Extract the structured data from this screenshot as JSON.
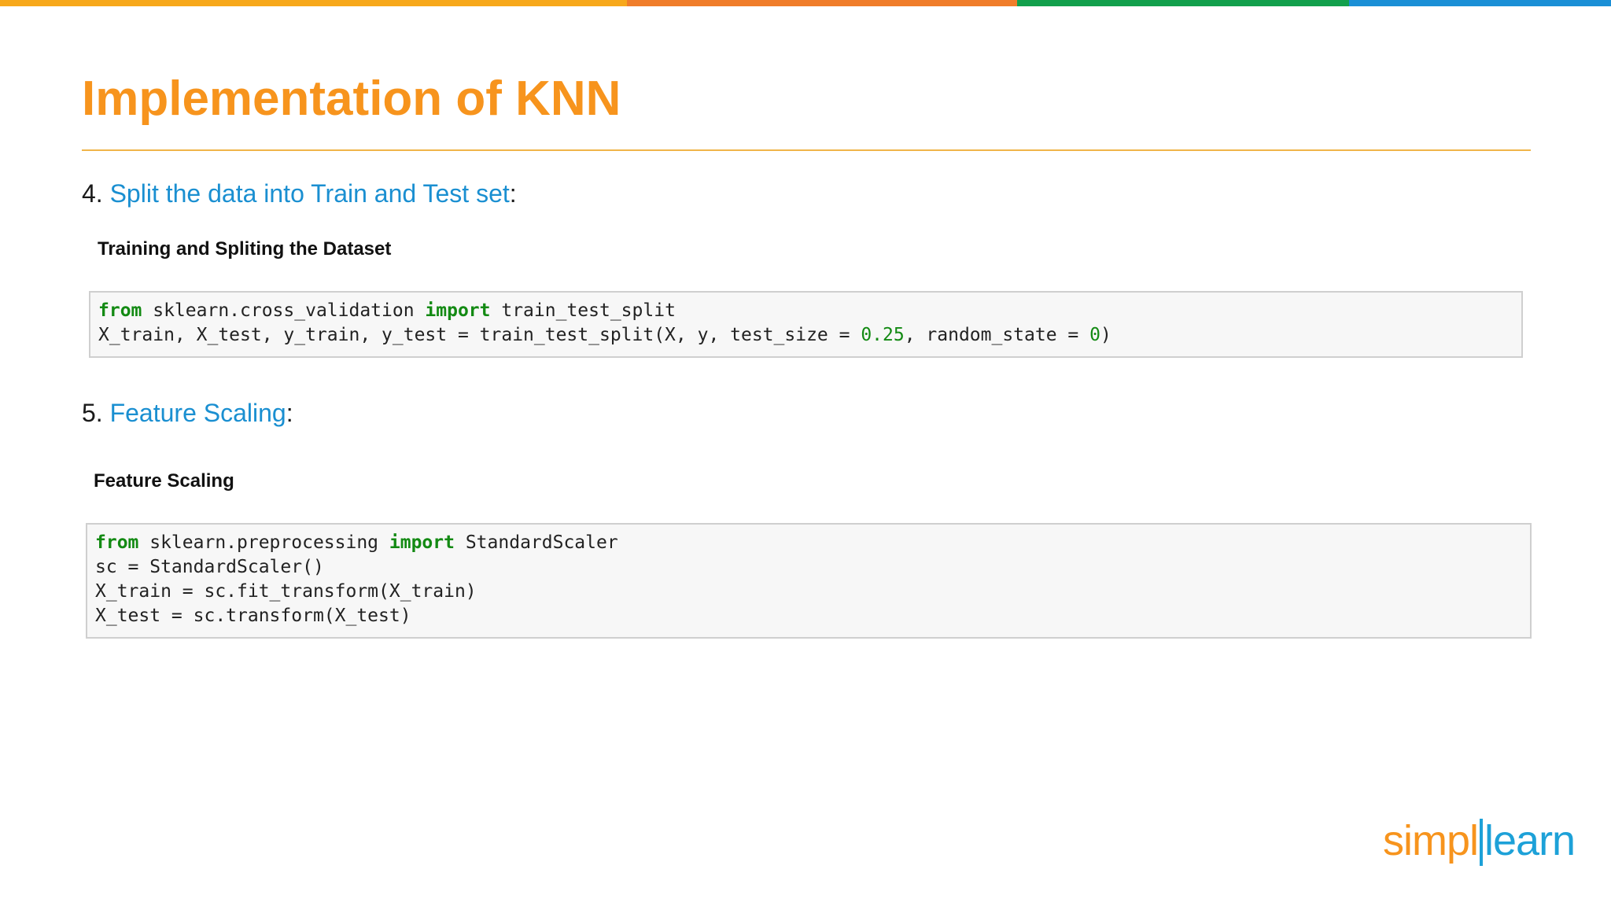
{
  "colors": {
    "top_bar": [
      "#f7a81b",
      "#f07d2a",
      "#12a04c",
      "#1b8fd6"
    ],
    "title": "#f7941d",
    "rule": "#f0b54a",
    "link": "#1a8fd1",
    "keyword": "#138a13",
    "number": "#138a13",
    "logo_simpli": "#f7941d",
    "logo_learn": "#1da1d8"
  },
  "slide": {
    "title": "Implementation of KNN"
  },
  "step4": {
    "number": "4.",
    "link_text": "Split the data into Train and Test set",
    "suffix": ":",
    "subheading": "Training and Spliting the Dataset",
    "code": {
      "line1": {
        "kw1": "from",
        "t1": " sklearn.cross_validation ",
        "kw2": "import",
        "t2": " train_test_split"
      },
      "line2": {
        "t1": "X_train, X_test, y_train, y_test = train_test_split(X, y, test_size = ",
        "n1": "0.25",
        "t2": ", random_state = ",
        "n2": "0",
        "t3": ")"
      }
    }
  },
  "step5": {
    "number": "5.",
    "link_text": "Feature Scaling",
    "suffix": ":",
    "subheading": "Feature Scaling",
    "code": {
      "line1": {
        "kw1": "from",
        "t1": " sklearn.preprocessing ",
        "kw2": "import",
        "t2": " StandardScaler"
      },
      "line2": "sc = StandardScaler()",
      "line3": "X_train = sc.fit_transform(X_train)",
      "line4": "X_test = sc.transform(X_test)"
    }
  },
  "logo": {
    "left": "simpl",
    "right": "learn"
  }
}
